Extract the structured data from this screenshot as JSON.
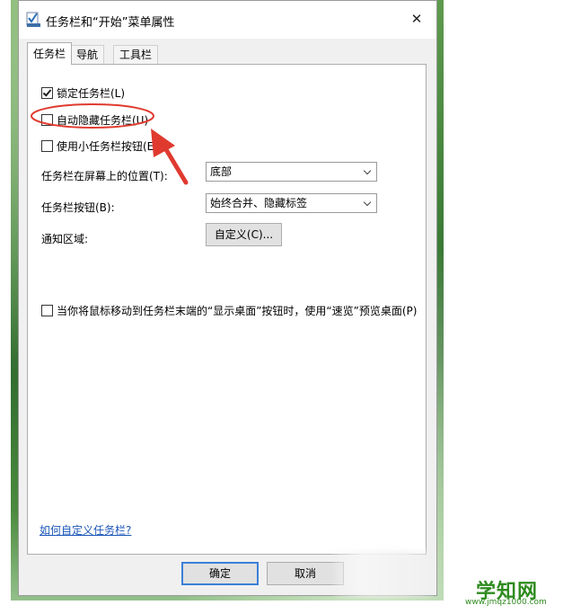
{
  "window": {
    "title": "任务栏和“开始”菜单属性",
    "close_glyph": "✕"
  },
  "tabs": [
    {
      "label": "任务栏",
      "selected": true
    },
    {
      "label": "导航",
      "selected": false
    },
    {
      "label": "工具栏",
      "selected": false
    }
  ],
  "options": {
    "lock_taskbar": {
      "label": "锁定任务栏(L)",
      "checked": true
    },
    "auto_hide": {
      "label": "自动隐藏任务栏(U)",
      "checked": false
    },
    "small_buttons": {
      "label": "使用小任务栏按钮(E)",
      "checked": false
    },
    "peek": {
      "label": "当你将鼠标移动到任务栏末端的“显示桌面”按钮时，使用“速览”预览桌面(P)",
      "checked": false
    }
  },
  "location": {
    "label": "任务栏在屏幕上的位置(T):",
    "value": "底部"
  },
  "buttons_combine": {
    "label": "任务栏按钮(B):",
    "value": "始终合并、隐藏标签"
  },
  "notification": {
    "label": "通知区域:",
    "button": "自定义(C)..."
  },
  "help_link": "如何自定义任务栏?",
  "footer": {
    "ok": "确定",
    "cancel": "取消"
  },
  "annotation": {
    "color": "#e03a2f"
  },
  "watermark": {
    "text": "学知网",
    "url": "www.jmqz1000.com"
  }
}
